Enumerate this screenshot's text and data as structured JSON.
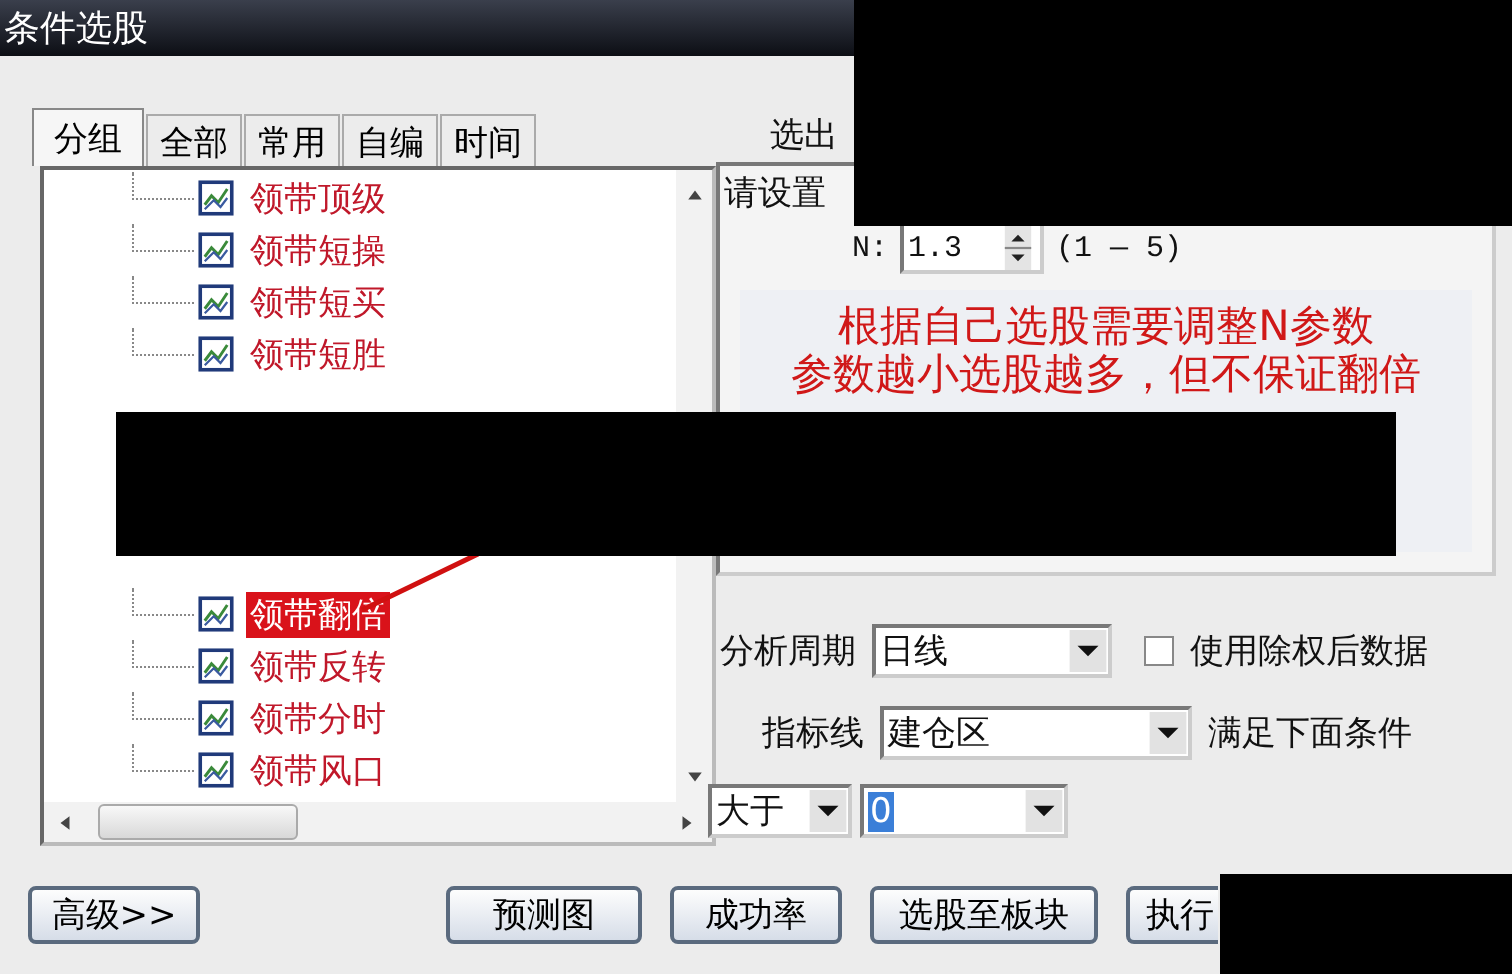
{
  "window": {
    "title": "条件选股"
  },
  "tabs": [
    {
      "label": "分组",
      "selected": true
    },
    {
      "label": "全部",
      "selected": false
    },
    {
      "label": "常用",
      "selected": false
    },
    {
      "label": "自编",
      "selected": false
    },
    {
      "label": "时间",
      "selected": false
    }
  ],
  "tree": {
    "items": [
      {
        "label": "领带顶级",
        "selected": false
      },
      {
        "label": "领带短操",
        "selected": false
      },
      {
        "label": "领带短买",
        "selected": false
      },
      {
        "label": "领带短胜",
        "selected": false
      },
      {
        "label": "领带翻倍",
        "selected": true
      },
      {
        "label": "领带反转",
        "selected": false
      },
      {
        "label": "领带分时",
        "selected": false
      },
      {
        "label": "领带风口",
        "selected": false
      }
    ]
  },
  "output_label": "选出",
  "params": {
    "heading": "请设置",
    "n_label": "N:",
    "n_value": "1.3",
    "n_range": "(1 — 5)",
    "notes": [
      "根据自己选股需要调整N参数",
      "参数越小选股越多，但不保证翻倍"
    ]
  },
  "period": {
    "label": "分析周期",
    "value": "日线"
  },
  "adjusted": {
    "label": "使用除权后数据",
    "checked": false
  },
  "indicator": {
    "label": "指标线",
    "value": "建仓区",
    "suffix": "满足下面条件"
  },
  "condition": {
    "operator": "大于",
    "value": "0"
  },
  "buttons": [
    "高级>>",
    "预测图",
    "成功率",
    "选股至板块",
    "执行"
  ]
}
